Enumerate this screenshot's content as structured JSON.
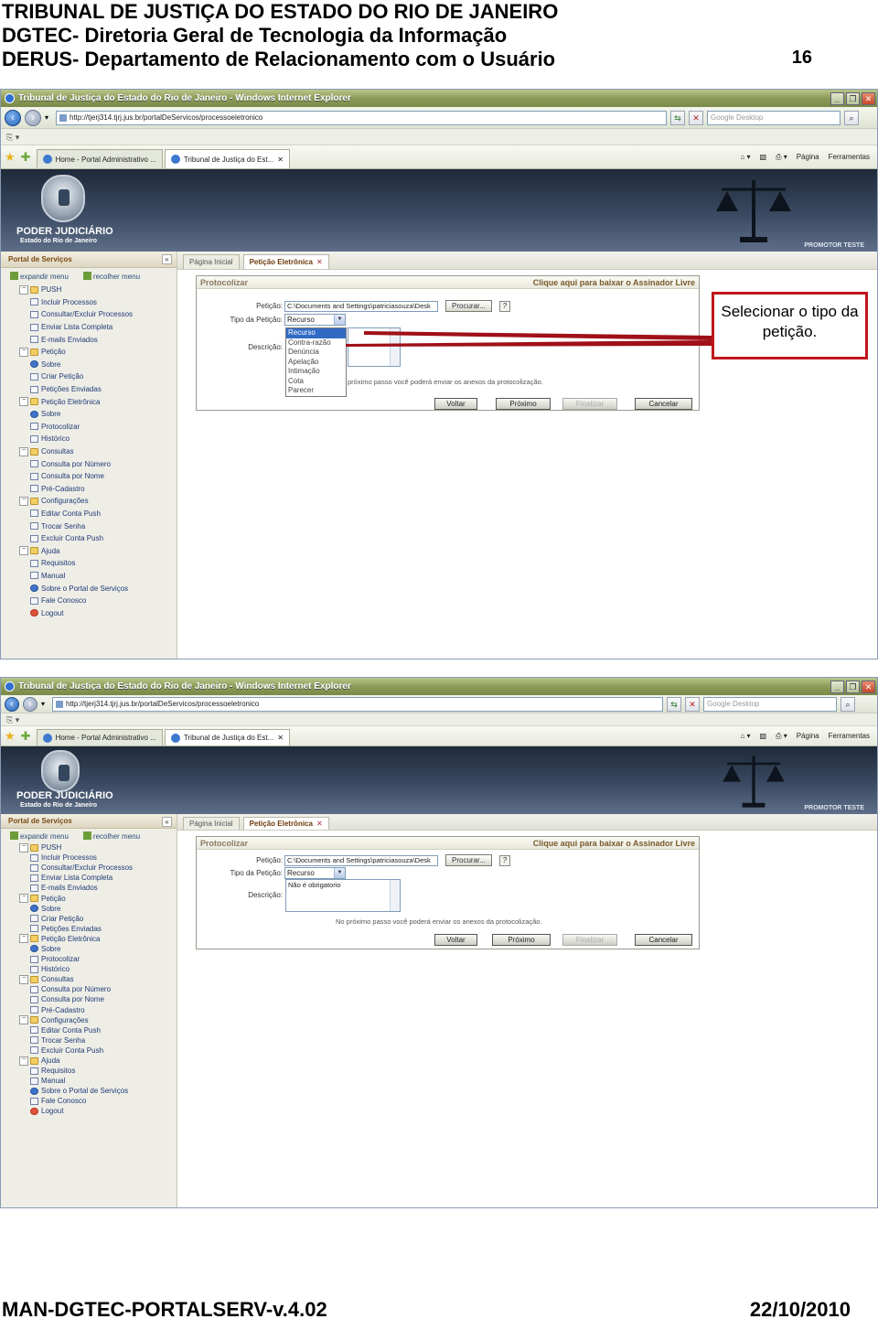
{
  "doc": {
    "header_lines": [
      "TRIBUNAL DE JUSTIÇA DO ESTADO DO RIO DE JANEIRO",
      "DGTEC- Diretoria Geral de Tecnologia da Informação",
      "DERUS- Departamento de Relacionamento com o Usuário"
    ],
    "page_number": "16",
    "footer_left": "MAN-DGTEC-PORTALSERV-v.4.02",
    "footer_right": "22/10/2010",
    "callout": "Selecionar o tipo da petição."
  },
  "browser": {
    "window_title": "Tribunal de Justiça do Estado do Rio de Janeiro - Windows Internet Explorer",
    "url": "http://tjerj314.tjrj.jus.br/portalDeServicos/processoeletronico",
    "search_placeholder": "Google Desktop",
    "tabs": [
      "Home - Portal Administrativo ...",
      "Tribunal de Justiça do Est..."
    ],
    "cmd_pagina": "Página",
    "cmd_ferramentas": "Ferramentas"
  },
  "banner": {
    "brand_line1": "PODER JUDICIÁRIO",
    "brand_line2": "Estado do Rio de Janeiro",
    "user": "PROMOTOR TESTE"
  },
  "sidebar": {
    "title": "Portal de Serviços",
    "expand": "expandir menu",
    "collapse": "recolher menu",
    "items": [
      {
        "label": "PUSH",
        "type": "folder"
      },
      {
        "label": "Incluir Processos",
        "type": "child"
      },
      {
        "label": "Consultar/Excluir Processos",
        "type": "child"
      },
      {
        "label": "Enviar Lista Completa",
        "type": "child"
      },
      {
        "label": "E-mails Enviados",
        "type": "child"
      },
      {
        "label": "Petição",
        "type": "folder"
      },
      {
        "label": "Sobre",
        "type": "info"
      },
      {
        "label": "Criar Petição",
        "type": "child"
      },
      {
        "label": "Petições Enviadas",
        "type": "child"
      },
      {
        "label": "Petição Eletrônica",
        "type": "folder"
      },
      {
        "label": "Sobre",
        "type": "info"
      },
      {
        "label": "Protocolizar",
        "type": "child"
      },
      {
        "label": "Histórico",
        "type": "child"
      },
      {
        "label": "Consultas",
        "type": "folder"
      },
      {
        "label": "Consulta por Número",
        "type": "child"
      },
      {
        "label": "Consulta por Nome",
        "type": "child"
      },
      {
        "label": "Pré-Cadastro",
        "type": "child"
      },
      {
        "label": "Configurações",
        "type": "folder"
      },
      {
        "label": "Editar Conta Push",
        "type": "child"
      },
      {
        "label": "Trocar Senha",
        "type": "child"
      },
      {
        "label": "Excluir Conta Push",
        "type": "child"
      },
      {
        "label": "Ajuda",
        "type": "folder"
      },
      {
        "label": "Requisitos",
        "type": "child"
      },
      {
        "label": "Manual",
        "type": "child"
      },
      {
        "label": "Sobre o Portal de Serviços",
        "type": "info"
      },
      {
        "label": "Fale Conosco",
        "type": "child"
      },
      {
        "label": "Logout",
        "type": "logout"
      }
    ]
  },
  "content": {
    "tab_home": "Página Inicial",
    "tab_active": "Petição Eletrônica",
    "panel_title": "Protocolizar",
    "download_link": "Clique aqui para baixar o Assinador Livre",
    "label_peticao": "Petição:",
    "peticao_path": "C:\\Documents and Settings\\patriciasouza\\Desk",
    "browse": "Procurar...",
    "label_tipo": "Tipo da Petição:",
    "tipo_selected": "Recurso",
    "tipo_options": [
      "Recurso",
      "Contra-razão",
      "Denúncia",
      "Apelação",
      "Intimação",
      "Cota",
      "Parecer"
    ],
    "label_descricao": "Descrição:",
    "descricao_value": "Não é obrigatorio",
    "note_partial": "próximo passo você poderá enviar os anexos da protocolização.",
    "note_full": "No próximo passo você poderá enviar os anexos da protocolização.",
    "btn_voltar": "Voltar",
    "btn_proximo": "Próximo",
    "btn_finalizar": "Finalizar",
    "btn_cancelar": "Cancelar"
  },
  "colors": {
    "callout_border": "#c0161c",
    "accent_blue": "#316ac5"
  }
}
